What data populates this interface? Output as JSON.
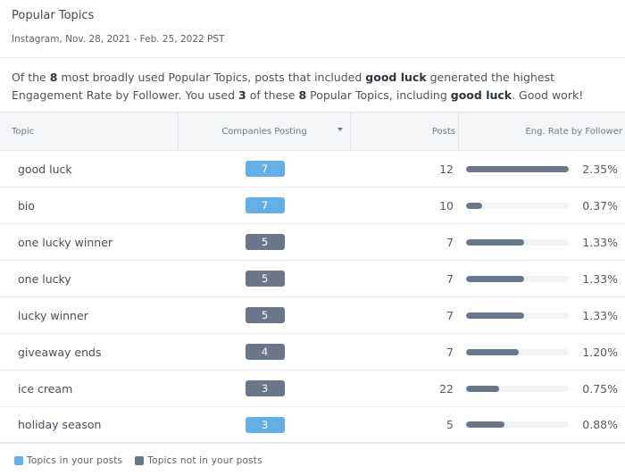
{
  "header": {
    "title": "Popular Topics",
    "subtitle": "Instagram, Nov. 28, 2021 - Feb. 25, 2022 PST"
  },
  "summary": {
    "p1": "Of the ",
    "b1": "8",
    "p2": " most broadly used Popular Topics, posts that included ",
    "b2": "good luck",
    "p3": " generated the highest Engagement Rate by Follower. You used ",
    "b3": "3",
    "p4": " of these ",
    "b4": "8",
    "p5": " Popular Topics, including ",
    "b5": "good luck",
    "p6": ". Good work!"
  },
  "table": {
    "columns": {
      "topic": "Topic",
      "companies": "Companies Posting",
      "posts": "Posts",
      "eng": "Eng. Rate by Follower"
    },
    "sort_icon": "caret-down-icon",
    "rows": [
      {
        "topic": "good luck",
        "companies": "7",
        "in_posts": true,
        "posts": "12",
        "rate": "2.35%",
        "rate_value": 2.35
      },
      {
        "topic": "bio",
        "companies": "7",
        "in_posts": true,
        "posts": "10",
        "rate": "0.37%",
        "rate_value": 0.37
      },
      {
        "topic": "one lucky winner",
        "companies": "5",
        "in_posts": false,
        "posts": "7",
        "rate": "1.33%",
        "rate_value": 1.33
      },
      {
        "topic": "one lucky",
        "companies": "5",
        "in_posts": false,
        "posts": "7",
        "rate": "1.33%",
        "rate_value": 1.33
      },
      {
        "topic": "lucky winner",
        "companies": "5",
        "in_posts": false,
        "posts": "7",
        "rate": "1.33%",
        "rate_value": 1.33
      },
      {
        "topic": "giveaway ends",
        "companies": "4",
        "in_posts": false,
        "posts": "7",
        "rate": "1.20%",
        "rate_value": 1.2
      },
      {
        "topic": "ice cream",
        "companies": "3",
        "in_posts": false,
        "posts": "22",
        "rate": "0.75%",
        "rate_value": 0.75
      },
      {
        "topic": "holiday season",
        "companies": "3",
        "in_posts": true,
        "posts": "5",
        "rate": "0.88%",
        "rate_value": 0.88
      }
    ],
    "rate_max": 2.35
  },
  "legend": {
    "in_label": "Topics in your posts",
    "out_label": "Topics not in your posts",
    "in_color": "#63b0e8",
    "out_color": "#6a7789"
  }
}
